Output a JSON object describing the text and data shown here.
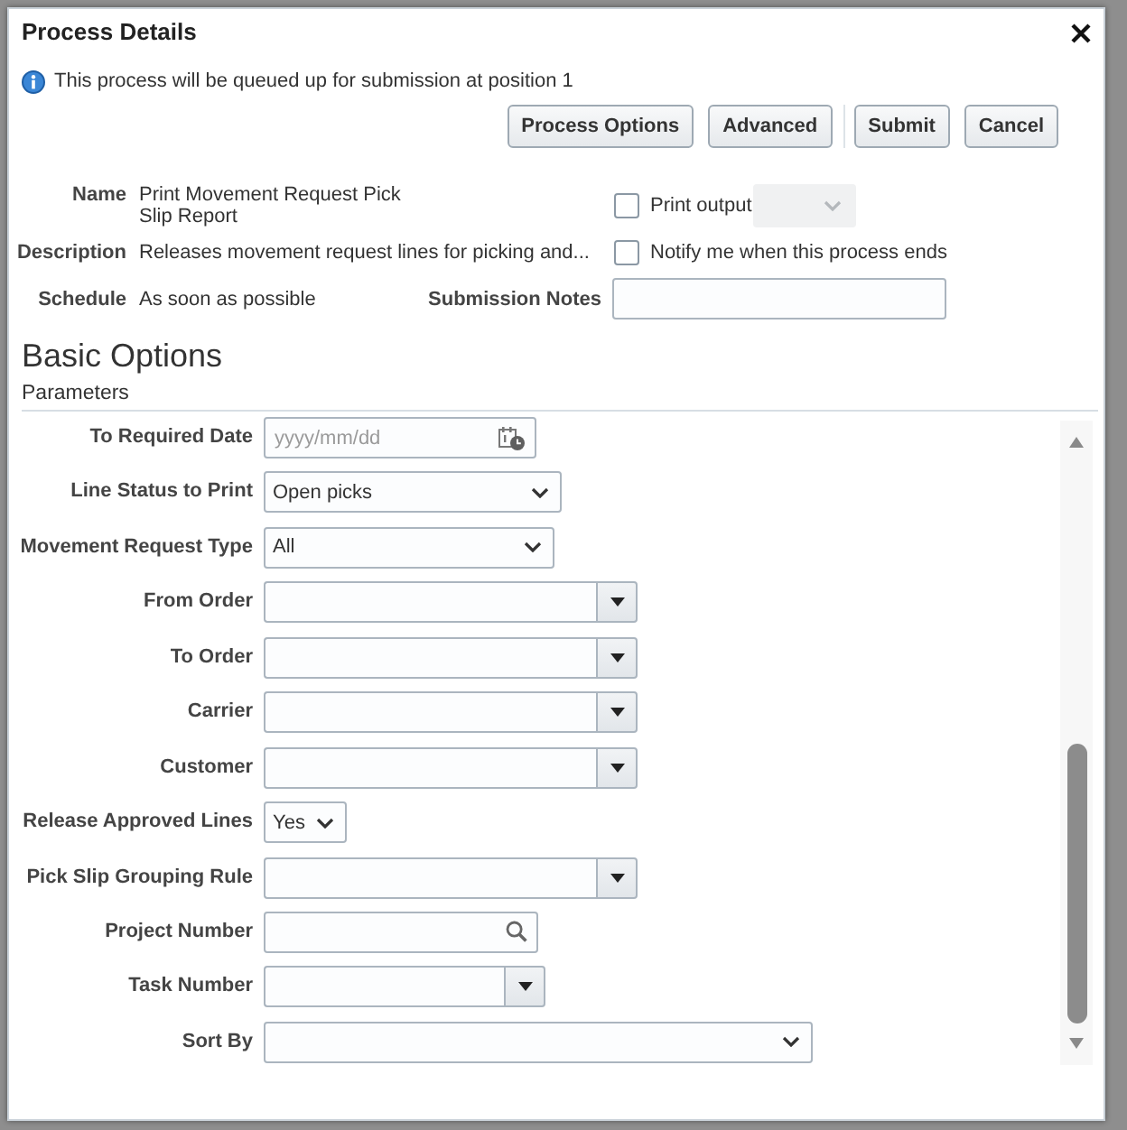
{
  "dialog": {
    "title": "Process Details"
  },
  "info_message": "This process will be queued up for submission at position 1",
  "button_groups": [
    [
      {
        "label": "Process Options"
      },
      {
        "label": "Advanced"
      }
    ],
    [
      {
        "label": "Submit"
      },
      {
        "label": "Cancel"
      }
    ]
  ],
  "summary": [
    {
      "label": "Name",
      "value": "Print Movement Request Pick Slip Report"
    },
    {
      "label": "Description",
      "value": "Releases movement request lines for picking and..."
    },
    {
      "label": "Schedule",
      "value": "As soon as possible"
    }
  ],
  "print_output": {
    "label": "Print output",
    "checked": false,
    "format_select_disabled": true
  },
  "notify": {
    "label": "Notify me when this process ends",
    "checked": false
  },
  "submission_notes": {
    "label": "Submission Notes"
  },
  "section_title": "Basic Options",
  "subsection_title": "Parameters",
  "parameters": [
    {
      "label": "To Required Date",
      "kind": "date",
      "placeholder": "yyyy/mm/dd"
    },
    {
      "label": "Line Status to Print",
      "kind": "select",
      "value": "Open picks"
    },
    {
      "label": "Movement Request Type",
      "kind": "select",
      "value": "All"
    },
    {
      "label": "From Order",
      "kind": "combo"
    },
    {
      "label": "To Order",
      "kind": "combo"
    },
    {
      "label": "Carrier",
      "kind": "combo"
    },
    {
      "label": "Customer",
      "kind": "combo"
    },
    {
      "label": "Release Approved Lines",
      "kind": "select",
      "value": "Yes"
    },
    {
      "label": "Pick Slip Grouping Rule",
      "kind": "combo"
    },
    {
      "label": "Project Number",
      "kind": "search"
    },
    {
      "label": "Task Number",
      "kind": "combo"
    },
    {
      "label": "Sort By",
      "kind": "select"
    }
  ]
}
